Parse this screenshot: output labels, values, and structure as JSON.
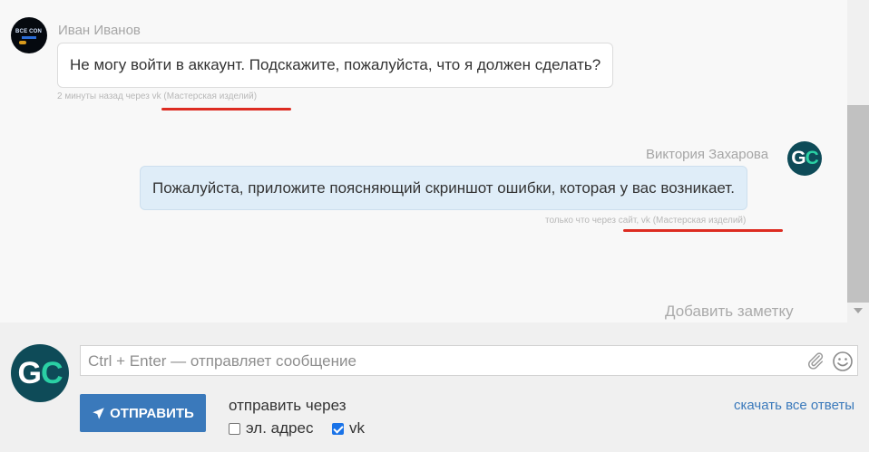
{
  "chat": {
    "messages": [
      {
        "author": "Иван Иванов",
        "text": "Не могу войти в аккаунт. Подскажите, пожалуйста, что я должен сделать?",
        "meta": "2 минуты назад через vk (Мастерская изделий)",
        "avatar": "ivan-logo-avatar",
        "direction": "incoming"
      },
      {
        "author": "Виктория Захарова",
        "text": "Пожалуйста, приложите поясняющий скриншот ошибки, которая у вас возникает.",
        "meta": "только что через сайт, vk (Мастерская изделий)",
        "avatar_letters": "GC",
        "direction": "outgoing"
      }
    ],
    "add_note": "Добавить заметку",
    "highlight_color": "#dd2c22"
  },
  "composer": {
    "avatar_letters": "GC",
    "input_placeholder": "Ctrl + Enter — отправляет сообщение",
    "input_value": "",
    "send_label": "ОТПРАВИТЬ",
    "send_icon": "paper-plane-icon",
    "send_via_label": "отправить через",
    "channels": [
      {
        "label": "эл. адрес",
        "checked": false
      },
      {
        "label": "vk",
        "checked": true
      }
    ],
    "download_link": "скачать все ответы"
  },
  "colors": {
    "accent": "#3a79bb",
    "avatar_bg": "#0e4b58",
    "avatar_accent": "#2ad0a4",
    "outgoing_bubble": "#dfedf8"
  }
}
